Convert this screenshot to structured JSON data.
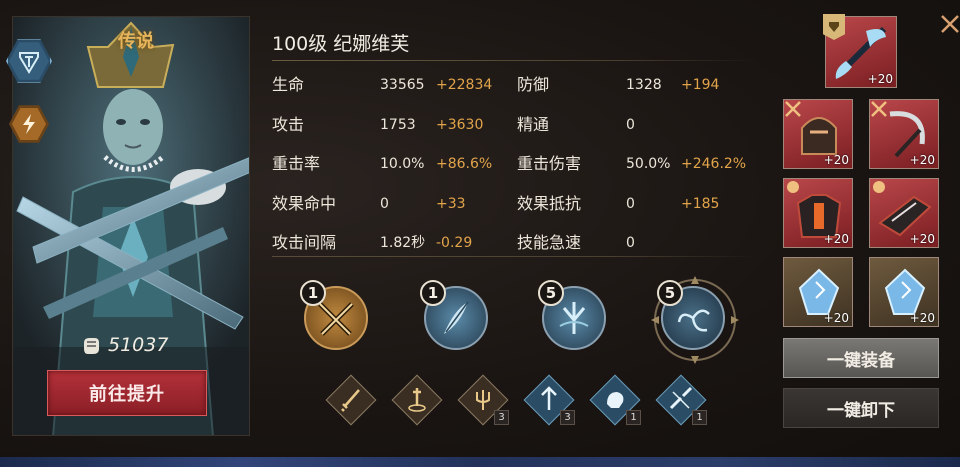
{
  "hero": {
    "rarity": "传说",
    "power": "51037",
    "upgrade_label": "前往提升",
    "title": "100级  纪娜维芙",
    "class_icon": "tower-shield-icon",
    "element_icon": "lightning-icon"
  },
  "stats": [
    {
      "label": "生命",
      "base": "33565",
      "bonus": "+22834",
      "label2": "防御",
      "base2": "1328",
      "bonus2": "+194"
    },
    {
      "label": "攻击",
      "base": "1753",
      "bonus": "+3630",
      "label2": "精通",
      "base2": "0",
      "bonus2": ""
    },
    {
      "label": "重击率",
      "base": "10.0%",
      "bonus": "+86.6%",
      "label2": "重击伤害",
      "base2": "50.0%",
      "bonus2": "+246.2%"
    },
    {
      "label": "效果命中",
      "base": "0",
      "bonus": "+33",
      "label2": "效果抵抗",
      "base2": "0",
      "bonus2": "+185"
    },
    {
      "label": "攻击间隔",
      "base": "1.82秒",
      "bonus": "-0.29",
      "label2": "技能急速",
      "base2": "0",
      "bonus2": ""
    }
  ],
  "skills": [
    {
      "level": "1",
      "icon": "crossed-swords-icon",
      "color": "#b77a34"
    },
    {
      "level": "1",
      "icon": "feather-blade-icon",
      "color": "#3a5e78"
    },
    {
      "level": "5",
      "icon": "trident-strike-icon",
      "color": "#3a5e78"
    },
    {
      "level": "5",
      "icon": "vortex-slash-icon",
      "color": "#34566e"
    }
  ],
  "runes": [
    {
      "icon": "sword-rune-icon",
      "count": ""
    },
    {
      "icon": "dagger-ground-rune-icon",
      "count": ""
    },
    {
      "icon": "trident-rune-icon",
      "count": "3"
    },
    {
      "icon": "arrow-up-rune-icon",
      "count": "3"
    },
    {
      "icon": "beast-rune-icon",
      "count": "1"
    },
    {
      "icon": "broken-blade-rune-icon",
      "count": "1"
    }
  ],
  "equipment": {
    "weapon": {
      "level": "+20",
      "icon": "glaive-icon"
    },
    "slots": [
      {
        "level": "+20",
        "icon": "helmet-icon"
      },
      {
        "level": "+20",
        "icon": "scythe-icon"
      },
      {
        "level": "+20",
        "icon": "armor-icon"
      },
      {
        "level": "+20",
        "icon": "gauntlet-icon"
      },
      {
        "level": "+20",
        "icon": "blue-crystal-icon"
      },
      {
        "level": "+20",
        "icon": "blue-crystal-icon"
      }
    ],
    "equip_all_label": "一键装备",
    "unequip_all_label": "一键卸下"
  },
  "colors": {
    "bonus": "#e2a44a",
    "upgrade_button": "#a02a32",
    "rarity": "#e6b45a"
  }
}
